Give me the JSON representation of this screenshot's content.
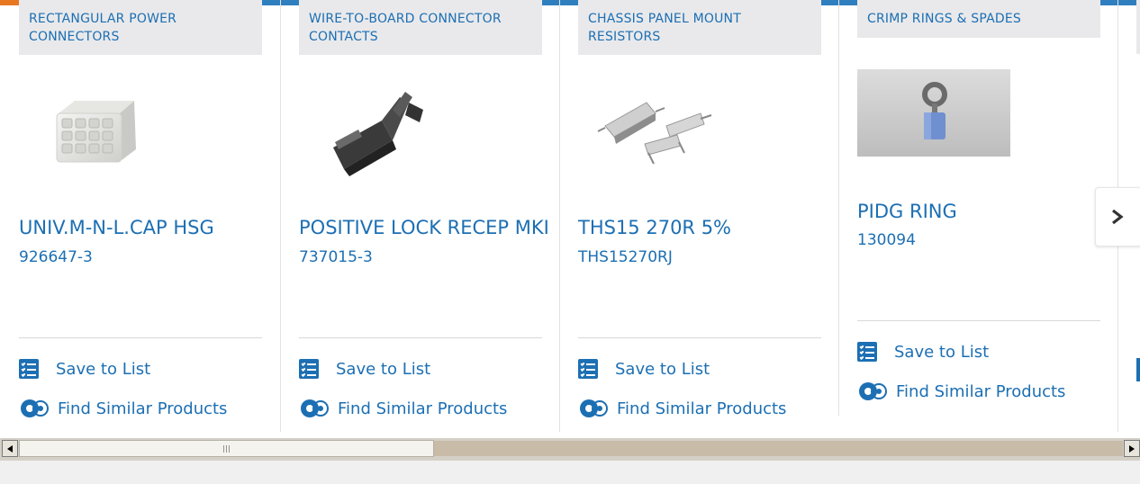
{
  "products": [
    {
      "category": "RECTANGULAR POWER CONNECTORS",
      "title": "UNIV.M-N-L.CAP HSG",
      "part_number": "926647-3",
      "image": "white-multi-pin-housing"
    },
    {
      "category": "WIRE-TO-BOARD CONNECTOR CONTACTS",
      "title": "POSITIVE LOCK RECEP MKI",
      "part_number": "737015-3",
      "image": "black-crimp-contact"
    },
    {
      "category": "CHASSIS PANEL MOUNT RESISTORS",
      "title": "THS15 270R 5%",
      "part_number": "THS15270RJ",
      "image": "aluminum-housed-resistors"
    },
    {
      "category": "CRIMP RINGS & SPADES",
      "title": "PIDG RING",
      "part_number": "130094",
      "image": "blue-ring-terminal"
    }
  ],
  "actions": {
    "save_label": "Save to List",
    "similar_label": "Find Similar Products"
  },
  "carousel": {
    "next_icon": "chevron-right-icon"
  },
  "colors": {
    "link_blue": "#1c6fb3",
    "top_bar": "#2f7fbf",
    "accent_orange": "#e87722",
    "category_bg": "#e9e9eb"
  }
}
